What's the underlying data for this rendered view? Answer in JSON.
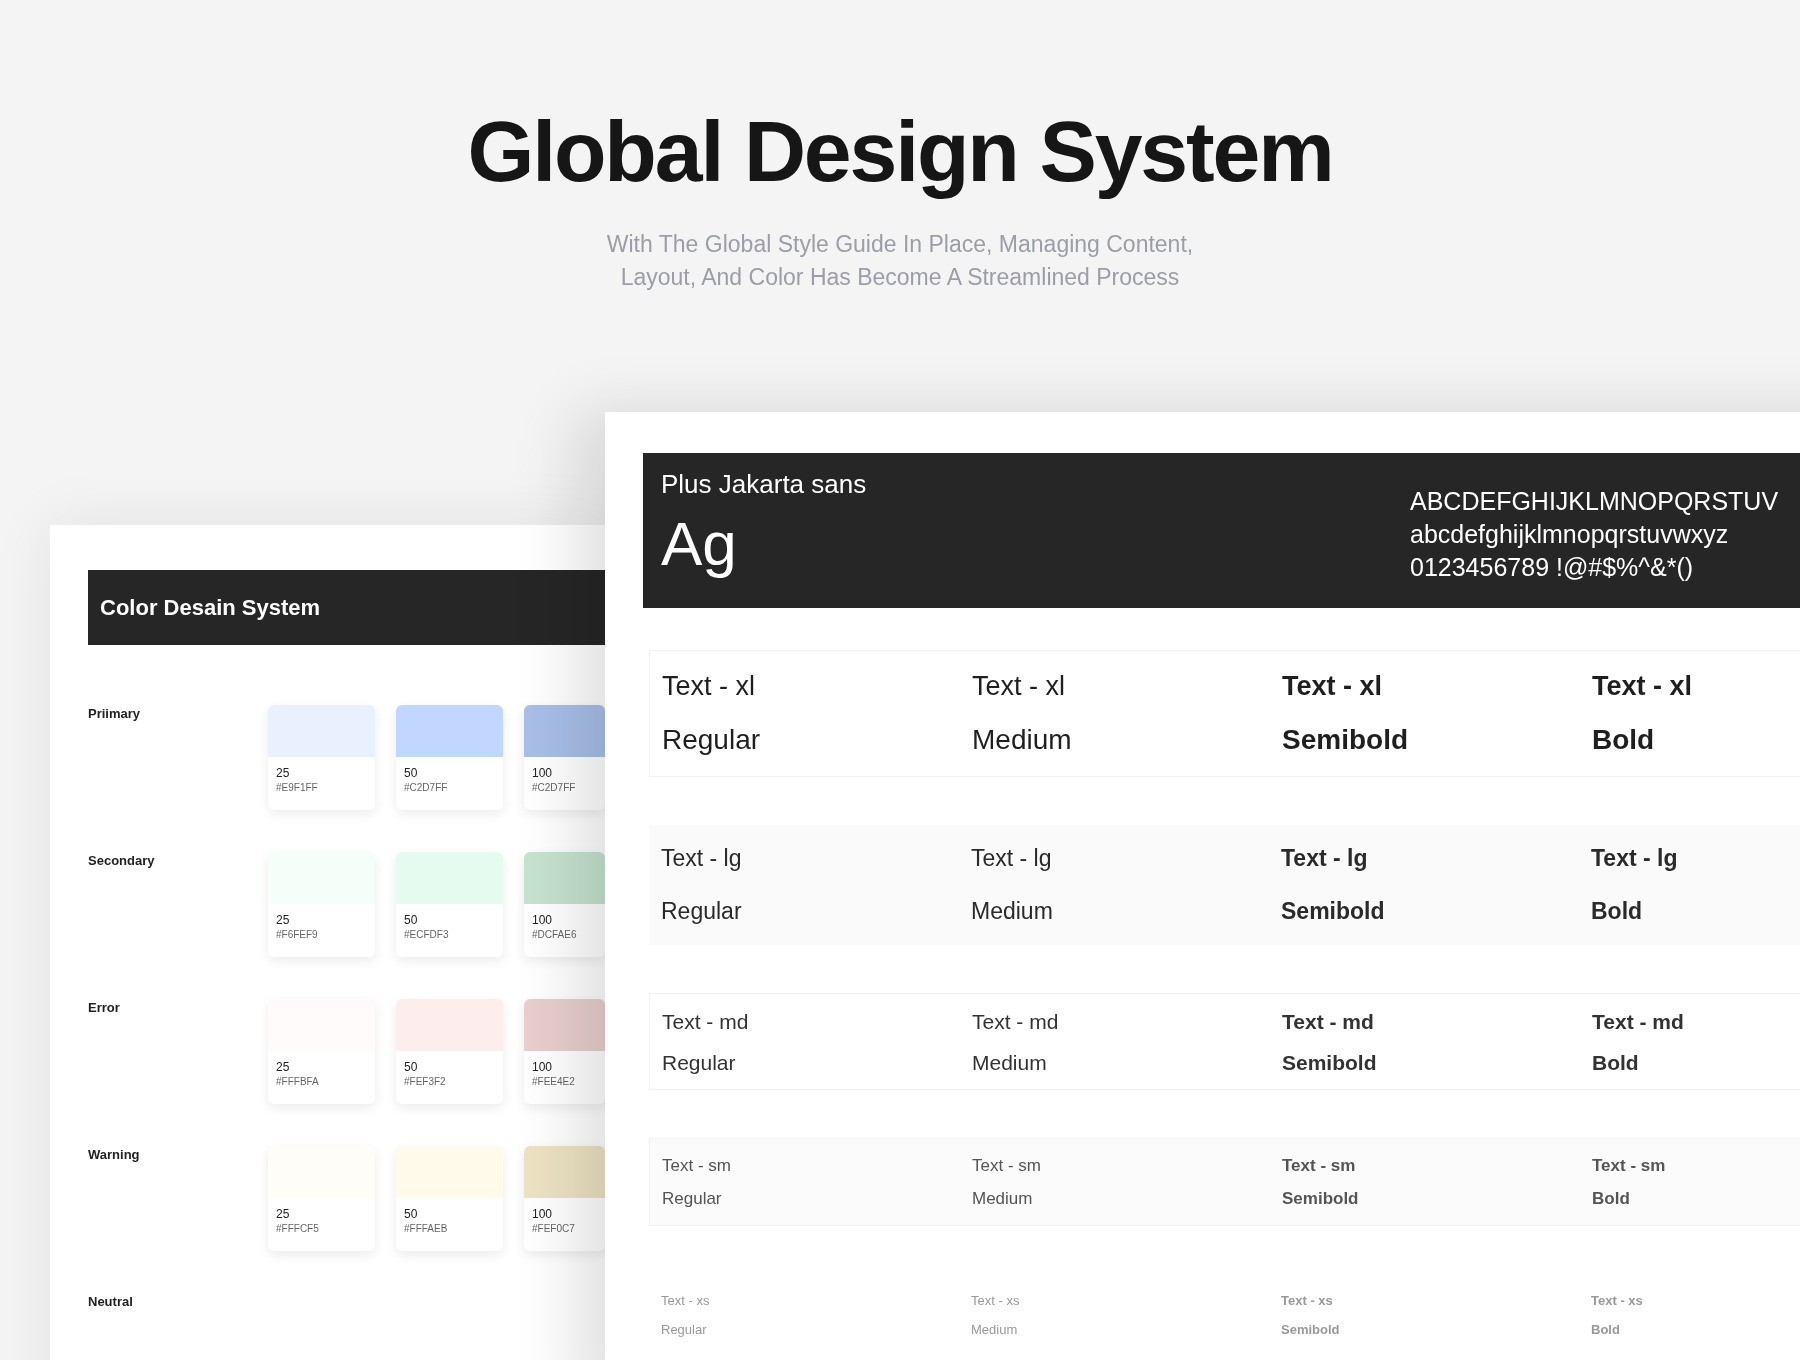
{
  "hero": {
    "title": "Global Design System",
    "subtitle_lines": [
      "With The Global Style Guide In Place, Managing Content,",
      "Layout, And Color Has Become A Streamlined Process"
    ]
  },
  "color_panel": {
    "title": "Color Desain System",
    "groups": [
      {
        "name": "Priimary",
        "swatches": [
          {
            "step": "25",
            "hex": "#E9F1FF",
            "color": "#e9f1ff"
          },
          {
            "step": "50",
            "hex": "#C2D7FF",
            "color": "#c2d7ff"
          },
          {
            "step": "100",
            "hex": "#C2D7FF",
            "color": "#a9bfe8"
          }
        ]
      },
      {
        "name": "Secondary",
        "swatches": [
          {
            "step": "25",
            "hex": "#F6FEF9",
            "color": "#f6fef9"
          },
          {
            "step": "50",
            "hex": "#ECFDF3",
            "color": "#e6fbef"
          },
          {
            "step": "100",
            "hex": "#DCFAE6",
            "color": "#c6e3cf"
          }
        ]
      },
      {
        "name": "Error",
        "swatches": [
          {
            "step": "25",
            "hex": "#FFFBFA",
            "color": "#fffbfa"
          },
          {
            "step": "50",
            "hex": "#FEF3F2",
            "color": "#fdeeed"
          },
          {
            "step": "100",
            "hex": "#FEE4E2",
            "color": "#e8cfcd"
          }
        ]
      },
      {
        "name": "Warning",
        "swatches": [
          {
            "step": "25",
            "hex": "#FFFCF5",
            "color": "#fffdf7"
          },
          {
            "step": "50",
            "hex": "#FFFAEB",
            "color": "#fffaea"
          },
          {
            "step": "100",
            "hex": "#FEF0C7",
            "color": "#ede3c3"
          }
        ]
      },
      {
        "name": "Neutral"
      }
    ]
  },
  "typography": {
    "font_name": "Plus Jakarta sans",
    "sample": "Ag",
    "glyph_lines": [
      "ABCDEFGHIJKLMNOPQRSTUV",
      "abcdefghijklmnopqrstuvwxyz",
      "0123456789 !@#$%^&*()"
    ],
    "rows": [
      {
        "kind": "xl",
        "cells": [
          {
            "kind": "regular",
            "size_label": "Text - xl",
            "weight_label": "Regular"
          },
          {
            "kind": "medium",
            "size_label": "Text - xl",
            "weight_label": "Medium"
          },
          {
            "kind": "semibold",
            "size_label": "Text - xl",
            "weight_label": "Semibold"
          },
          {
            "kind": "bold",
            "size_label": "Text - xl",
            "weight_label": "Bold"
          }
        ]
      },
      {
        "kind": "lg",
        "cells": [
          {
            "kind": "regular",
            "size_label": "Text - lg",
            "weight_label": "Regular"
          },
          {
            "kind": "medium",
            "size_label": "Text - lg",
            "weight_label": "Medium"
          },
          {
            "kind": "semibold",
            "size_label": "Text - lg",
            "weight_label": "Semibold"
          },
          {
            "kind": "bold",
            "size_label": "Text - lg",
            "weight_label": "Bold"
          }
        ]
      },
      {
        "kind": "md",
        "cells": [
          {
            "kind": "regular",
            "size_label": "Text - md",
            "weight_label": "Regular"
          },
          {
            "kind": "medium",
            "size_label": "Text - md",
            "weight_label": "Medium"
          },
          {
            "kind": "semibold",
            "size_label": "Text - md",
            "weight_label": "Semibold"
          },
          {
            "kind": "bold",
            "size_label": "Text - md",
            "weight_label": "Bold"
          }
        ]
      },
      {
        "kind": "sm",
        "cells": [
          {
            "kind": "regular",
            "size_label": "Text - sm",
            "weight_label": "Regular"
          },
          {
            "kind": "medium",
            "size_label": "Text - sm",
            "weight_label": "Medium"
          },
          {
            "kind": "semibold",
            "size_label": "Text - sm",
            "weight_label": "Semibold"
          },
          {
            "kind": "bold",
            "size_label": "Text - sm",
            "weight_label": "Bold"
          }
        ]
      },
      {
        "kind": "xs",
        "cells": [
          {
            "kind": "regular",
            "size_label": "Text - xs",
            "weight_label": "Regular"
          },
          {
            "kind": "medium",
            "size_label": "Text - xs",
            "weight_label": "Medium"
          },
          {
            "kind": "semibold",
            "size_label": "Text - xs",
            "weight_label": "Semibold"
          },
          {
            "kind": "bold",
            "size_label": "Text - xs",
            "weight_label": "Bold"
          }
        ]
      }
    ]
  }
}
